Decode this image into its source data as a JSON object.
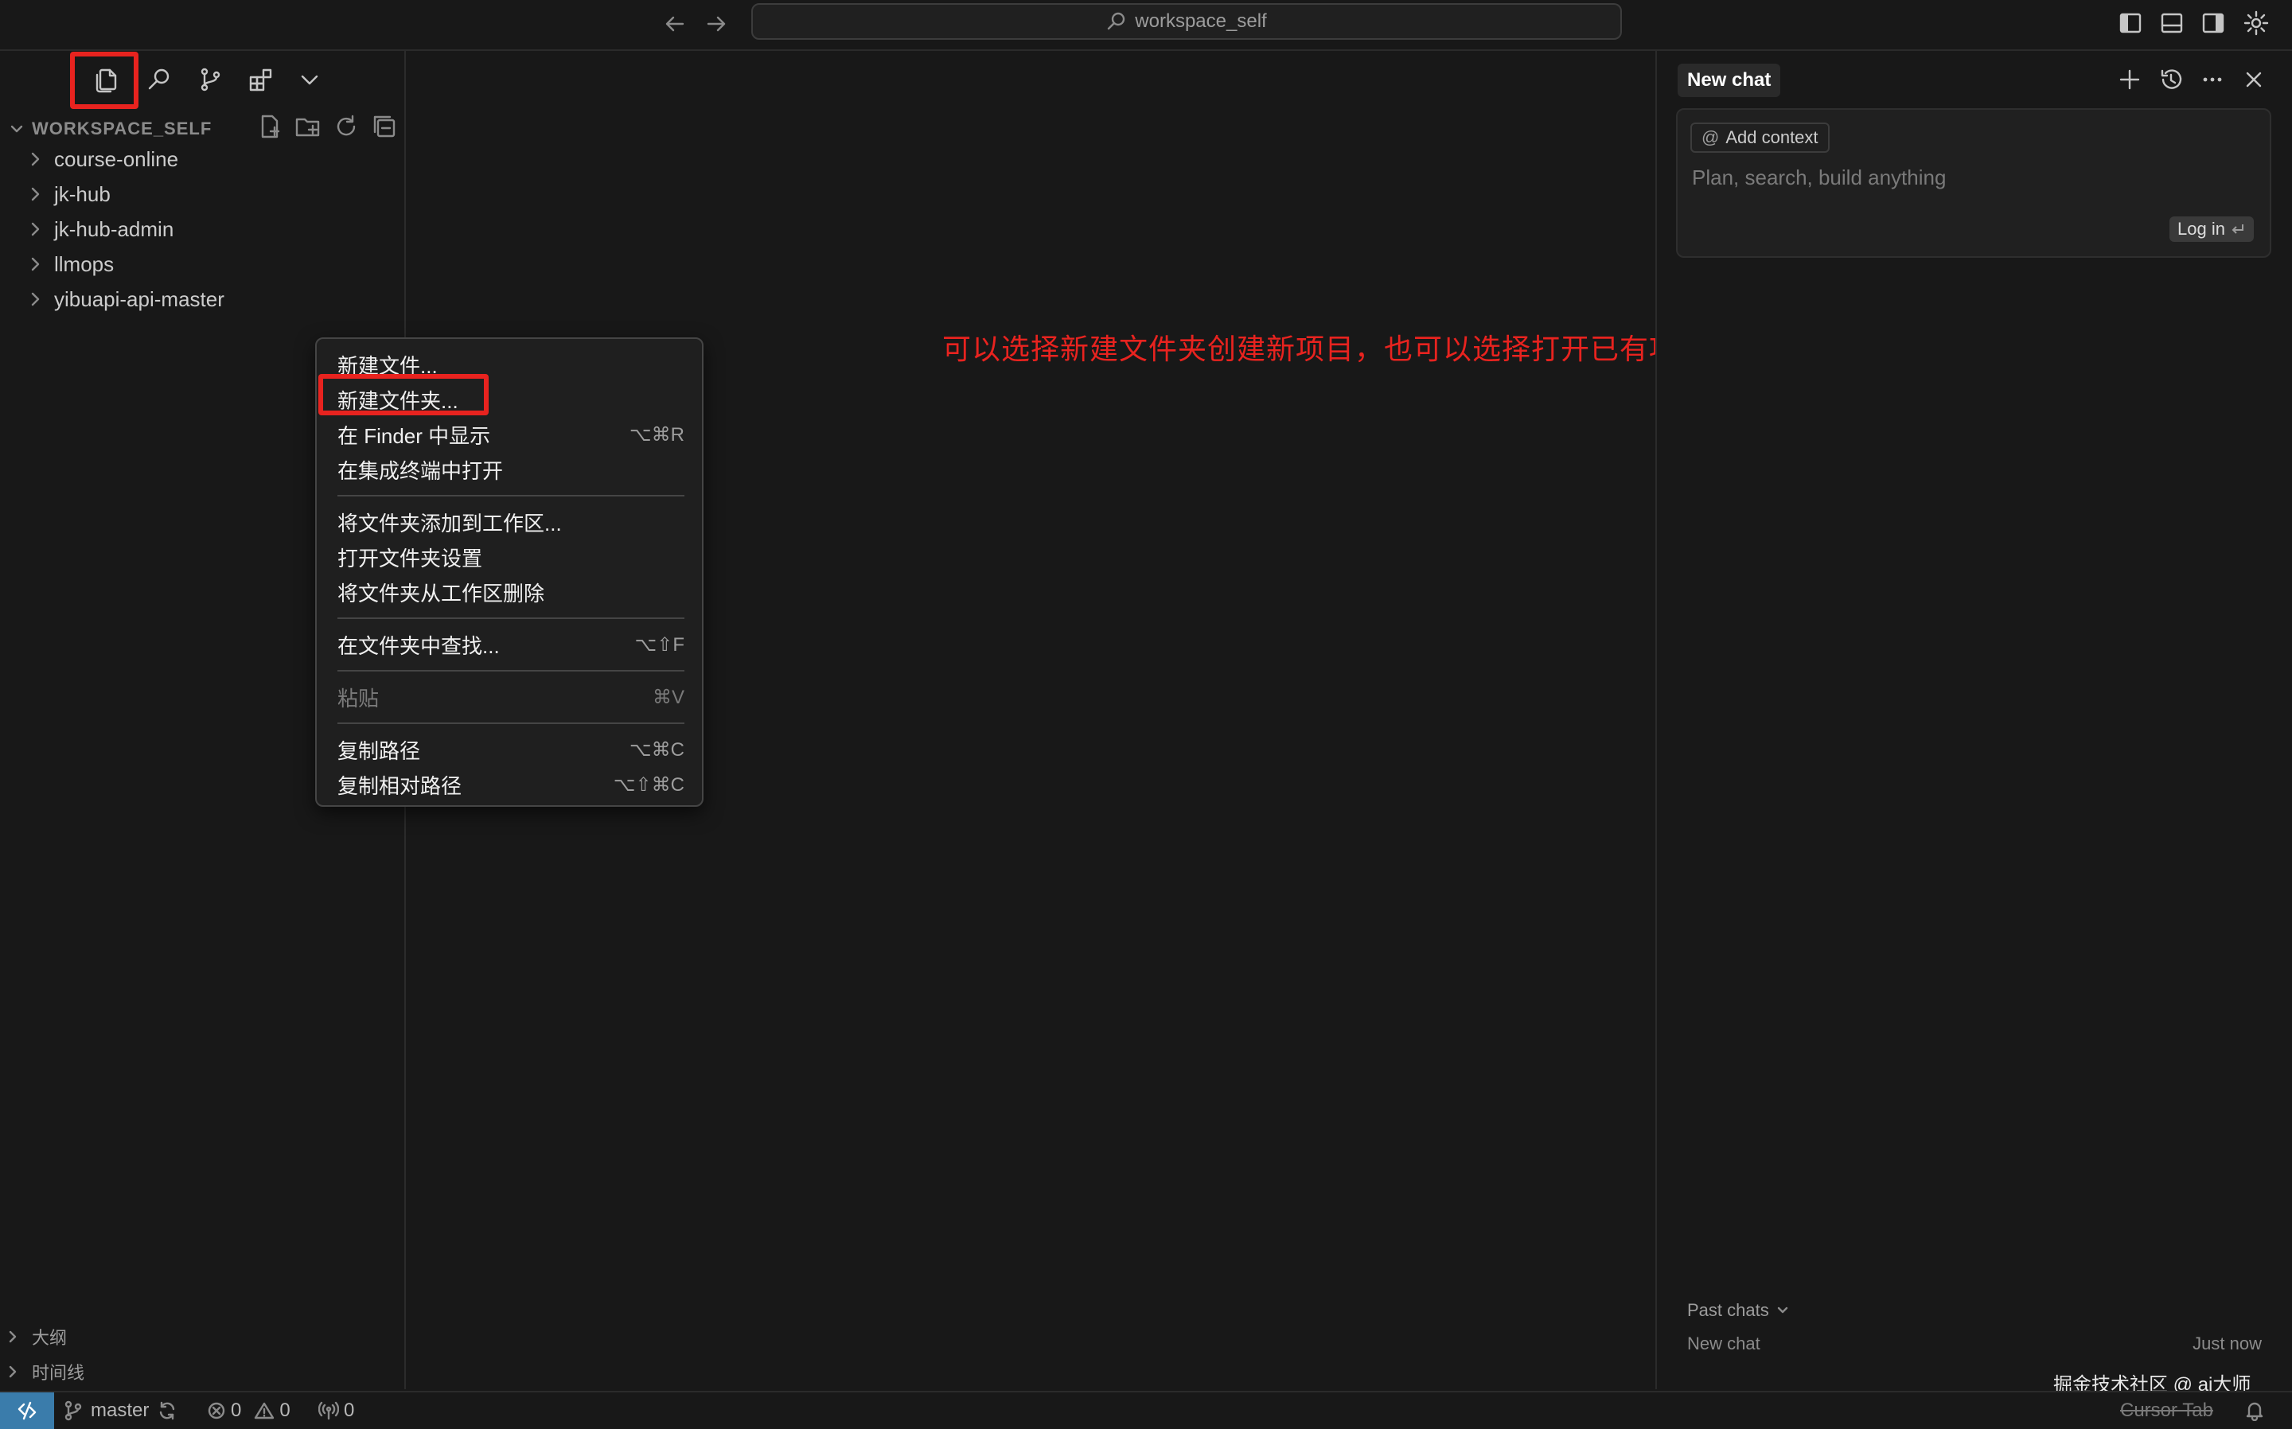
{
  "titlebar": {
    "search_text": "workspace_self"
  },
  "sidebar": {
    "section_title": "WORKSPACE_SELF",
    "tree": [
      {
        "label": "course-online"
      },
      {
        "label": "jk-hub"
      },
      {
        "label": "jk-hub-admin"
      },
      {
        "label": "llmops"
      },
      {
        "label": "yibuapi-api-master"
      }
    ],
    "bottom_sections": [
      {
        "label": "大纲"
      },
      {
        "label": "时间线"
      }
    ]
  },
  "context_menu": {
    "items": [
      {
        "label": "新建文件...",
        "shortcut": ""
      },
      {
        "label": "新建文件夹...",
        "shortcut": ""
      },
      {
        "label": "在 Finder 中显示",
        "shortcut": "⌥⌘R"
      },
      {
        "label": "在集成终端中打开",
        "shortcut": ""
      },
      {
        "label": "将文件夹添加到工作区...",
        "shortcut": ""
      },
      {
        "label": "打开文件夹设置",
        "shortcut": ""
      },
      {
        "label": "将文件夹从工作区删除",
        "shortcut": ""
      },
      {
        "label": "在文件夹中查找...",
        "shortcut": "⌥⇧F"
      },
      {
        "label": "粘贴",
        "shortcut": "⌘V"
      },
      {
        "label": "复制路径",
        "shortcut": "⌥⌘C"
      },
      {
        "label": "复制相对路径",
        "shortcut": "⌥⇧⌘C"
      }
    ]
  },
  "annotation": {
    "text": "可以选择新建文件夹创建新项目，也可以选择打开已有项目",
    "color": "#e8231f"
  },
  "chat": {
    "tab_label": "New chat",
    "add_context_label": "Add context",
    "input_placeholder": "Plan, search, build anything",
    "login_label": "Log in",
    "past_chats_label": "Past chats",
    "history": [
      {
        "title": "New chat",
        "time": "Just now"
      }
    ]
  },
  "statusbar": {
    "branch": "master",
    "errors": "0",
    "warnings": "0",
    "ports": "0",
    "cursor_tab": "Cursor Tab"
  },
  "watermark": "掘金技术社区 @ ai大师",
  "colors": {
    "background": "#181818",
    "accent_remote": "#3a7cab",
    "highlight_red": "#e8231f"
  }
}
